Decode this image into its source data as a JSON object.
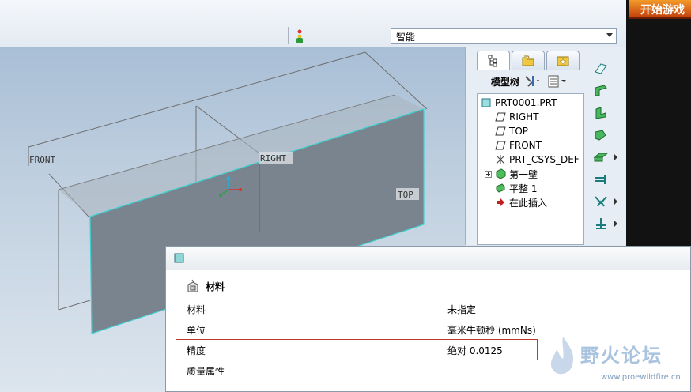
{
  "toolbar": {
    "filter_value": "智能"
  },
  "ad": {
    "banner_text": "开始游戏"
  },
  "viewport": {
    "labels": {
      "front": "FRONT",
      "right": "RIGHT",
      "top": "TOP"
    }
  },
  "model_tree": {
    "title": "模型树",
    "items": [
      {
        "label": "PRT0001.PRT",
        "icon": "part-icon"
      },
      {
        "label": "RIGHT",
        "icon": "datum-plane-icon"
      },
      {
        "label": "TOP",
        "icon": "datum-plane-icon"
      },
      {
        "label": "FRONT",
        "icon": "datum-plane-icon"
      },
      {
        "label": "PRT_CSYS_DEF",
        "icon": "csys-icon"
      },
      {
        "label": "第一壁",
        "icon": "sheetmetal-wall-icon"
      },
      {
        "label": "平整 1",
        "icon": "flat-wall-icon"
      },
      {
        "label": "在此插入",
        "icon": "insert-here-icon"
      }
    ]
  },
  "dialog": {
    "section_title": "材料",
    "rows": [
      {
        "key": "材料",
        "value": "未指定"
      },
      {
        "key": "单位",
        "value": "毫米牛顿秒 (mmNs)"
      },
      {
        "key": "精度",
        "value": "绝对 0.0125"
      },
      {
        "key": "质量属性",
        "value": ""
      }
    ]
  },
  "watermark": {
    "name": "野火论坛",
    "url": "www.proewildfire.cn"
  },
  "colors": {
    "model_edge": "#40d0d0",
    "highlight_box": "#c0392b",
    "viewport_top": "#a9bfd6"
  }
}
